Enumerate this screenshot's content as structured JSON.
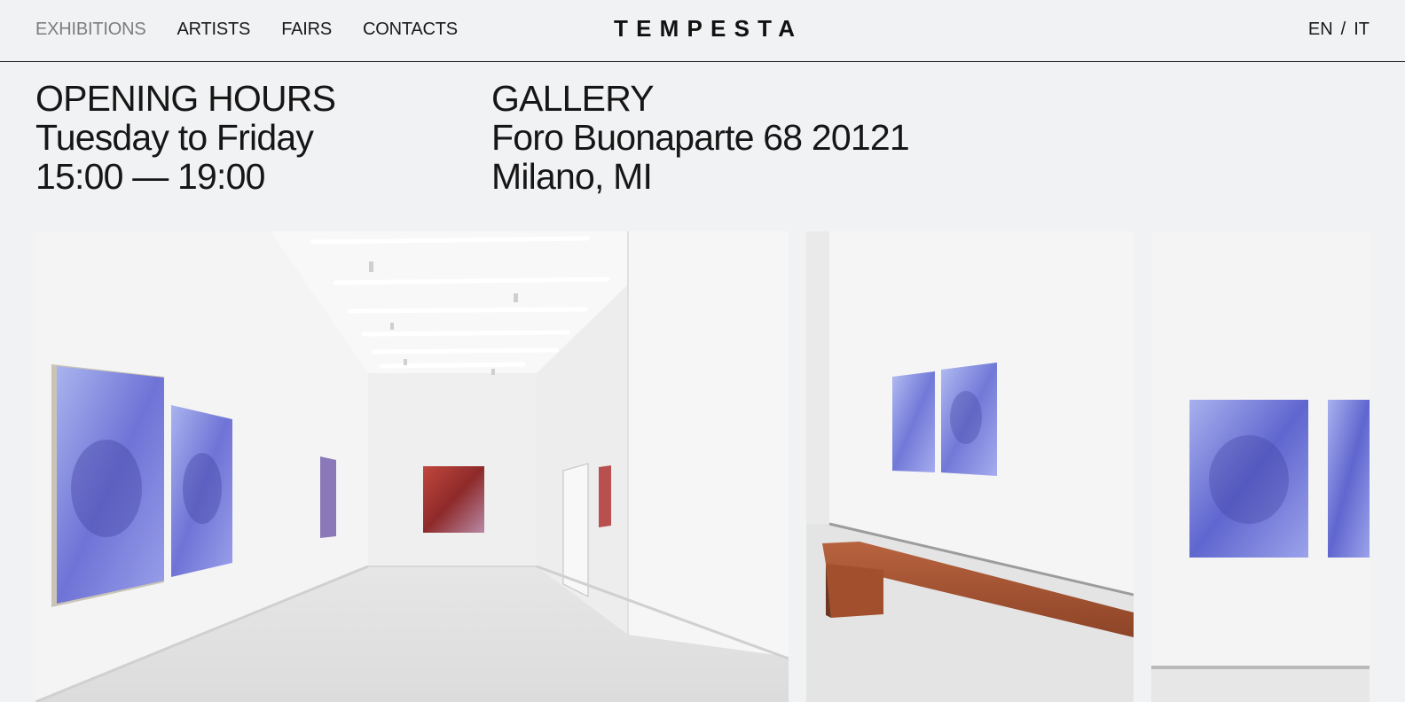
{
  "nav": {
    "items": [
      {
        "label": "EXHIBITIONS",
        "active": true
      },
      {
        "label": "ARTISTS"
      },
      {
        "label": "FAIRS"
      },
      {
        "label": "CONTACTS"
      }
    ]
  },
  "brand": {
    "logo": "TEMPESTA"
  },
  "language": {
    "en": "EN",
    "separator": "/",
    "it": "IT"
  },
  "hours": {
    "heading": "OPENING HOURS",
    "days": "Tuesday to Friday",
    "time": "15:00 — 19:00"
  },
  "gallery": {
    "heading": "GALLERY",
    "address": "Foro Buonaparte 68 20121",
    "city": "Milano, MI"
  },
  "colors": {
    "background": "#f1f2f3",
    "text": "#161616",
    "active_nav": "#7d7d7d"
  }
}
